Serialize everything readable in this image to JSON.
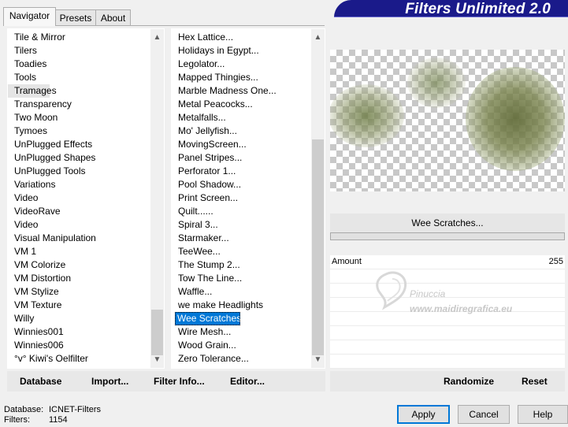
{
  "tabs": [
    "Navigator",
    "Presets",
    "About"
  ],
  "banner": "Filters Unlimited 2.0",
  "categories": [
    "Tile & Mirror",
    "Tilers",
    "Toadies",
    "Tools",
    "Tramages",
    "Transparency",
    "Two Moon",
    "Tymoes",
    "UnPlugged Effects",
    "UnPlugged Shapes",
    "UnPlugged Tools",
    "Variations",
    "Video",
    "VideoRave",
    "Video",
    "Visual Manipulation",
    "VM 1",
    "VM Colorize",
    "VM Distortion",
    "VM Stylize",
    "VM Texture",
    "Willy",
    "Winnies001",
    "Winnies006",
    "°v° Kiwi's Oelfilter"
  ],
  "filters": [
    "Hex Lattice...",
    "Holidays in Egypt...",
    "Legolator...",
    "Mapped Thingies...",
    "Marble Madness One...",
    "Metal Peacocks...",
    "Metalfalls...",
    "Mo' Jellyfish...",
    "MovingScreen...",
    "Panel Stripes...",
    "Perforator 1...",
    "Pool Shadow...",
    "Print Screen...",
    "Quilt......",
    "Spiral 3...",
    "Starmaker...",
    "TeeWee...",
    "The Stump 2...",
    "Tow The Line...",
    "Waffle...",
    "we make Headlights",
    "Wee Scratches...",
    "Wire Mesh...",
    "Wood Grain...",
    "Zero Tolerance..."
  ],
  "selected_filter_name": "Wee Scratches...",
  "params": {
    "amount_label": "Amount",
    "amount_value": "255"
  },
  "watermark": {
    "name": "Pinuccia",
    "url": "www.maidiregrafica.eu"
  },
  "left_buttons": {
    "database": "Database",
    "import": "Import...",
    "filter_info": "Filter Info...",
    "editor": "Editor..."
  },
  "right_buttons": {
    "randomize": "Randomize",
    "reset": "Reset"
  },
  "status": {
    "db_label": "Database:",
    "db_value": "ICNET-Filters",
    "filters_label": "Filters:",
    "filters_value": "1154"
  },
  "dialog": {
    "apply": "Apply",
    "cancel": "Cancel",
    "help": "Help"
  },
  "icons": {
    "scroll_up": "▲",
    "scroll_down": "▼"
  },
  "colors": {
    "banner": "#1a1a8a",
    "selection": "#0078d7"
  }
}
